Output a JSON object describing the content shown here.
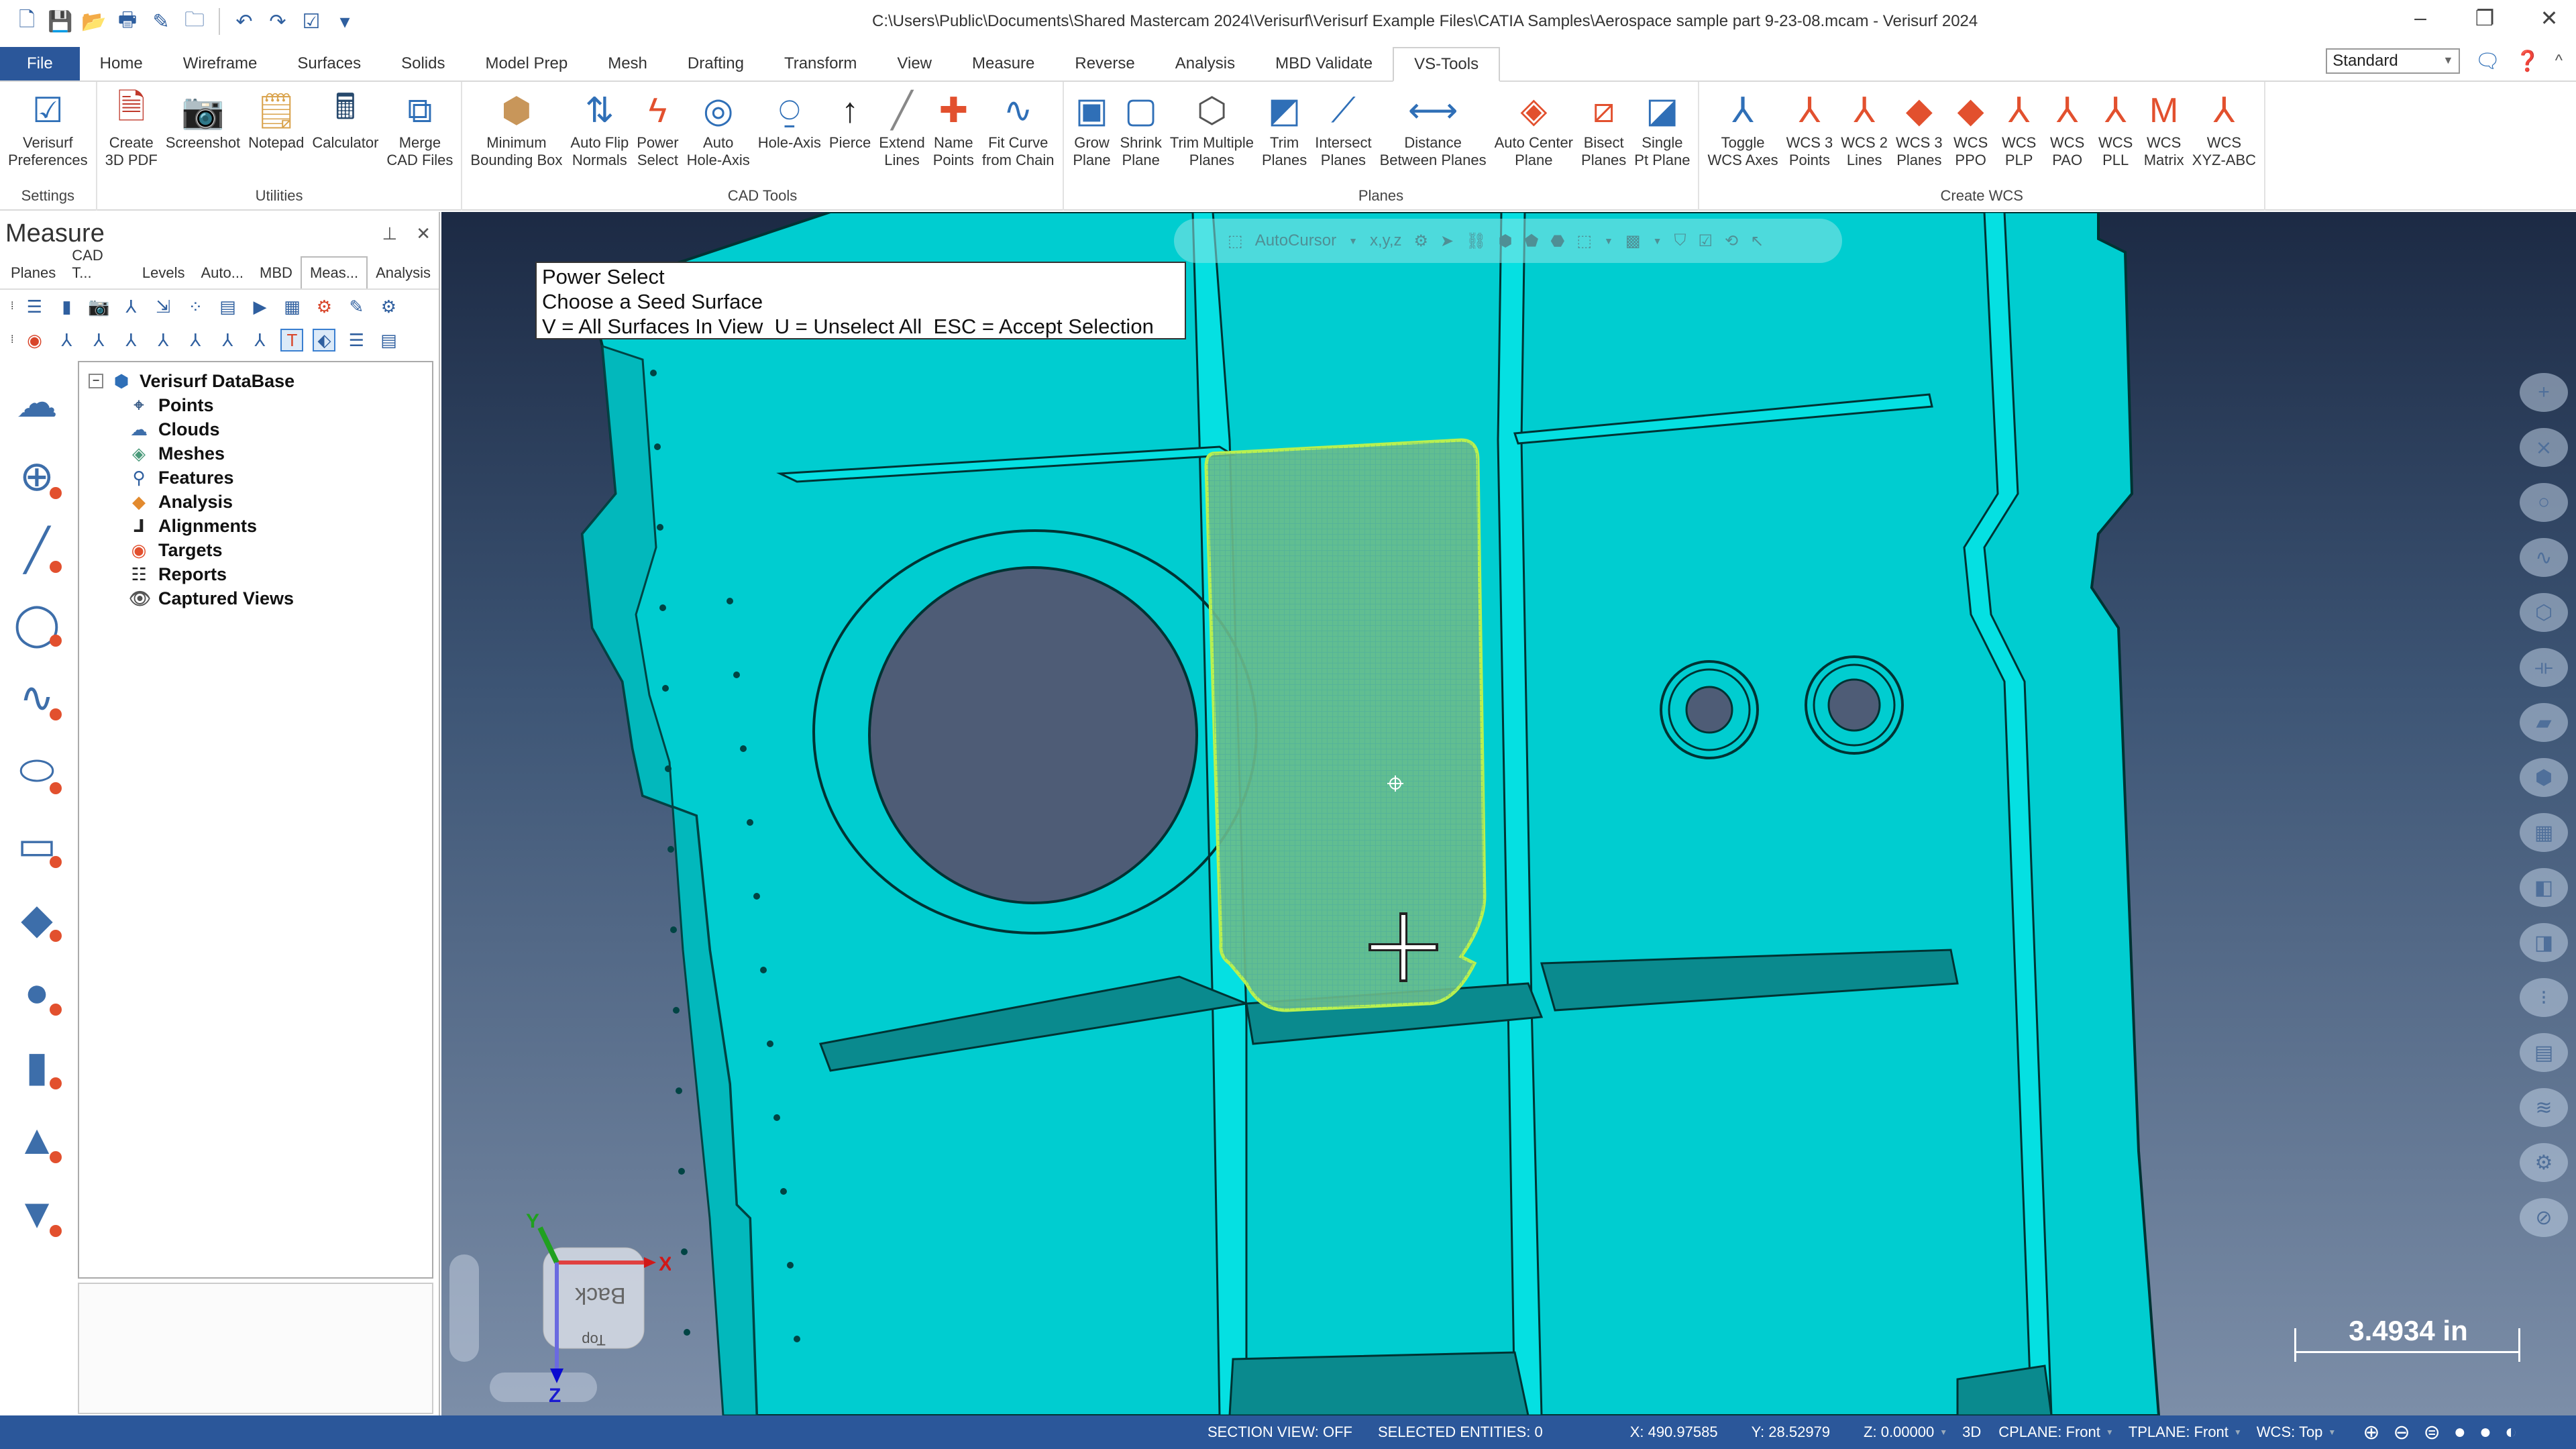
{
  "window": {
    "title": "C:\\Users\\Public\\Documents\\Shared Mastercam 2024\\Verisurf\\Verisurf Example Files\\CATIA Samples\\Aerospace sample part 9-23-08.mcam - Verisurf 2024",
    "minimize": "–",
    "restore": "❐",
    "close": "✕"
  },
  "quick_access": [
    {
      "name": "new-file-icon",
      "glyph": "🗋"
    },
    {
      "name": "save-icon",
      "glyph": "💾"
    },
    {
      "name": "open-folder-icon",
      "glyph": "📂"
    },
    {
      "name": "print-icon",
      "glyph": "🖶"
    },
    {
      "name": "save-as-icon",
      "glyph": "✎"
    },
    {
      "name": "zip-folder-icon",
      "glyph": "🗀"
    },
    {
      "name": "undo-icon",
      "glyph": "↶"
    },
    {
      "name": "redo-icon",
      "glyph": "↷"
    },
    {
      "name": "checklist-icon",
      "glyph": "☑"
    },
    {
      "name": "customize-qat-icon",
      "glyph": "▾"
    }
  ],
  "ribbon": {
    "tabs": [
      "File",
      "Home",
      "Wireframe",
      "Surfaces",
      "Solids",
      "Model Prep",
      "Mesh",
      "Drafting",
      "Transform",
      "View",
      "Measure",
      "Reverse",
      "Analysis",
      "MBD Validate",
      "VS-Tools"
    ],
    "active_tab": "VS-Tools",
    "style_select": "Standard",
    "groups": [
      {
        "label": "Settings",
        "items": [
          {
            "label": "Verisurf\nPreferences",
            "icon": "preferences-icon",
            "glyph": "☑",
            "color": "#2f6fb7"
          }
        ]
      },
      {
        "label": "Utilities",
        "items": [
          {
            "label": "Create\n3D PDF",
            "icon": "pdf-3d-icon",
            "glyph": "🗎",
            "color": "#c0392b"
          },
          {
            "label": "Screenshot",
            "icon": "screenshot-icon",
            "glyph": "📷",
            "color": "#3b6fb0"
          },
          {
            "label": "Notepad",
            "icon": "notepad-icon",
            "glyph": "🗒",
            "color": "#d9a24b"
          },
          {
            "label": "Calculator",
            "icon": "calculator-icon",
            "glyph": "🖩",
            "color": "#27496d"
          },
          {
            "label": "Merge\nCAD Files",
            "icon": "merge-icon",
            "glyph": "⧉",
            "color": "#2f6fb7"
          }
        ]
      },
      {
        "label": "CAD Tools",
        "items": [
          {
            "label": "Minimum\nBounding Box",
            "icon": "bounding-box-icon",
            "glyph": "⬢",
            "color": "#c8965a"
          },
          {
            "label": "Auto Flip\nNormals",
            "icon": "flip-normals-icon",
            "glyph": "⇅",
            "color": "#2f6fb7"
          },
          {
            "label": "Power\nSelect",
            "icon": "lightning-icon",
            "glyph": "ϟ",
            "color": "#e2502e"
          },
          {
            "label": "Auto\nHole-Axis",
            "icon": "auto-hole-axis-icon",
            "glyph": "◎",
            "color": "#2f6fb7"
          },
          {
            "label": "Hole-Axis",
            "icon": "hole-axis-icon",
            "glyph": "⍜",
            "color": "#2f6fb7"
          },
          {
            "label": "Pierce",
            "icon": "pierce-icon",
            "glyph": "↑",
            "color": "#222"
          },
          {
            "label": "Extend\nLines",
            "icon": "extend-lines-icon",
            "glyph": "╱",
            "color": "#888"
          },
          {
            "label": "Name\nPoints",
            "icon": "name-points-icon",
            "glyph": "✚",
            "color": "#e2502e"
          },
          {
            "label": "Fit Curve\nfrom Chain",
            "icon": "fit-curve-icon",
            "glyph": "∿",
            "color": "#2f6fb7"
          }
        ]
      },
      {
        "label": "Planes",
        "items": [
          {
            "label": "Grow\nPlane",
            "icon": "grow-plane-icon",
            "glyph": "▣",
            "color": "#2f6fb7"
          },
          {
            "label": "Shrink\nPlane",
            "icon": "shrink-plane-icon",
            "glyph": "▢",
            "color": "#2f6fb7"
          },
          {
            "label": "Trim Multiple\nPlanes",
            "icon": "trim-multiple-icon",
            "glyph": "⬡",
            "color": "#555"
          },
          {
            "label": "Trim\nPlanes",
            "icon": "trim-planes-icon",
            "glyph": "◩",
            "color": "#2f6fb7"
          },
          {
            "label": "Intersect\nPlanes",
            "icon": "intersect-planes-icon",
            "glyph": "⟋",
            "color": "#2f6fb7"
          },
          {
            "label": "Distance\nBetween Planes",
            "icon": "distance-planes-icon",
            "glyph": "⟷",
            "color": "#2f6fb7"
          },
          {
            "label": "Auto Center\nPlane",
            "icon": "auto-center-plane-icon",
            "glyph": "◈",
            "color": "#e2502e"
          },
          {
            "label": "Bisect\nPlanes",
            "icon": "bisect-planes-icon",
            "glyph": "⧄",
            "color": "#e2502e"
          },
          {
            "label": "Single\nPt Plane",
            "icon": "single-pt-plane-icon",
            "glyph": "◪",
            "color": "#2f6fb7"
          }
        ]
      },
      {
        "label": "Create WCS",
        "items": [
          {
            "label": "Toggle\nWCS Axes",
            "icon": "toggle-wcs-icon",
            "glyph": "⅄",
            "color": "#2f6fb7"
          },
          {
            "label": "WCS 3\nPoints",
            "icon": "wcs-3-points-icon",
            "glyph": "⅄",
            "color": "#e2502e"
          },
          {
            "label": "WCS 2\nLines",
            "icon": "wcs-2-lines-icon",
            "glyph": "⅄",
            "color": "#e2502e"
          },
          {
            "label": "WCS 3\nPlanes",
            "icon": "wcs-3-planes-icon",
            "glyph": "◆",
            "color": "#e2502e"
          },
          {
            "label": "WCS\nPPO",
            "icon": "wcs-ppo-icon",
            "glyph": "◆",
            "color": "#e2502e"
          },
          {
            "label": "WCS\nPLP",
            "icon": "wcs-plp-icon",
            "glyph": "⅄",
            "color": "#e2502e"
          },
          {
            "label": "WCS\nPAO",
            "icon": "wcs-pao-icon",
            "glyph": "⅄",
            "color": "#e2502e"
          },
          {
            "label": "WCS\nPLL",
            "icon": "wcs-pll-icon",
            "glyph": "⅄",
            "color": "#e2502e"
          },
          {
            "label": "WCS\nMatrix",
            "icon": "wcs-matrix-icon",
            "glyph": "M",
            "color": "#e2502e"
          },
          {
            "label": "WCS\nXYZ-ABC",
            "icon": "wcs-xyz-abc-icon",
            "glyph": "⅄",
            "color": "#e2502e"
          }
        ]
      }
    ]
  },
  "left_panel": {
    "title": "Measure",
    "pin": "📌",
    "close": "✕",
    "tabs": [
      "Planes",
      "CAD T...",
      "Levels",
      "Auto...",
      "MBD",
      "Meas...",
      "Analysis"
    ],
    "active_tab": "Meas...",
    "toolbar_row1": [
      {
        "name": "checklist-icon",
        "glyph": "☰"
      },
      {
        "name": "book-icon",
        "glyph": "▮"
      },
      {
        "name": "camera-icon",
        "glyph": "📷"
      },
      {
        "name": "axes-icon",
        "glyph": "⅄"
      },
      {
        "name": "import-icon",
        "glyph": "⇲"
      },
      {
        "name": "point-import-icon",
        "glyph": "⁘"
      },
      {
        "name": "list-icon",
        "glyph": "▤"
      },
      {
        "name": "play-icon",
        "glyph": "▶"
      },
      {
        "name": "report-icon",
        "glyph": "▦"
      },
      {
        "name": "probe-settings-icon",
        "glyph": "⚙"
      },
      {
        "name": "edit-file-icon",
        "glyph": "✎"
      },
      {
        "name": "device-settings-icon",
        "glyph": "⚙"
      }
    ],
    "toolbar_row2": [
      {
        "name": "target-icon",
        "glyph": "◉",
        "selected": false
      },
      {
        "name": "align-best-fit-icon",
        "glyph": "⅄",
        "selected": false
      },
      {
        "name": "align-points-icon",
        "glyph": "⅄",
        "selected": false
      },
      {
        "name": "align-3-2-1-icon",
        "glyph": "⅄",
        "selected": false
      },
      {
        "name": "align-feature-icon",
        "glyph": "⅄",
        "selected": false
      },
      {
        "name": "align-analysis-icon",
        "glyph": "⅄",
        "selected": false
      },
      {
        "name": "align-box-icon",
        "glyph": "⅄",
        "selected": false
      },
      {
        "name": "align-wcs-icon",
        "glyph": "⅄",
        "selected": false
      },
      {
        "name": "robot-arm-icon",
        "glyph": "T",
        "selected": true
      },
      {
        "name": "tag-icon",
        "glyph": "⬖",
        "selected": true
      },
      {
        "name": "layer-list-icon",
        "glyph": "☰",
        "selected": false
      },
      {
        "name": "device-icon",
        "glyph": "▤",
        "selected": false
      }
    ],
    "side_tools": [
      {
        "name": "cloud-measure-icon",
        "glyph": "☁"
      },
      {
        "name": "point-measure-icon",
        "glyph": "⊕"
      },
      {
        "name": "line-measure-icon",
        "glyph": "╱"
      },
      {
        "name": "circle-measure-icon",
        "glyph": "◯"
      },
      {
        "name": "curve-measure-icon",
        "glyph": "∿"
      },
      {
        "name": "ellipse-measure-icon",
        "glyph": "⬭"
      },
      {
        "name": "slot-measure-icon",
        "glyph": "▭"
      },
      {
        "name": "plane-measure-icon",
        "glyph": "◆"
      },
      {
        "name": "sphere-measure-icon",
        "glyph": "●"
      },
      {
        "name": "cylinder-measure-icon",
        "glyph": "▮"
      },
      {
        "name": "cone-measure-icon",
        "glyph": "▲"
      },
      {
        "name": "countersink-measure-icon",
        "glyph": "▼"
      }
    ],
    "tree": {
      "root": "Verisurf DataBase",
      "items": [
        {
          "label": "Points",
          "icon": "points-icon",
          "glyph": "⌖",
          "color": "#3d5f8a"
        },
        {
          "label": "Clouds",
          "icon": "clouds-icon",
          "glyph": "☁",
          "color": "#3d6eaa"
        },
        {
          "label": "Meshes",
          "icon": "meshes-icon",
          "glyph": "◈",
          "color": "#4a9a7a"
        },
        {
          "label": "Features",
          "icon": "features-icon",
          "glyph": "⚲",
          "color": "#2f5f9f"
        },
        {
          "label": "Analysis",
          "icon": "analysis-icon",
          "glyph": "◆",
          "color": "#e28a2e"
        },
        {
          "label": "Alignments",
          "icon": "alignments-icon",
          "glyph": "⅃",
          "color": "#222"
        },
        {
          "label": "Targets",
          "icon": "targets-icon",
          "glyph": "◉",
          "color": "#e2502e"
        },
        {
          "label": "Reports",
          "icon": "reports-icon",
          "glyph": "☷",
          "color": "#222"
        },
        {
          "label": "Captured Views",
          "icon": "captured-views-icon",
          "glyph": "👁",
          "color": "#555"
        }
      ]
    }
  },
  "viewport": {
    "prompt": {
      "line1": "Power Select",
      "line2": "Choose a Seed Surface",
      "line3": "V = All Surfaces In View  U = Unselect All  ESC = Accept Selection"
    },
    "autocursor": {
      "label": "AutoCursor",
      "xyz_label": "x,y,z"
    },
    "nav_buttons": [
      {
        "name": "point-nav-icon",
        "glyph": "+"
      },
      {
        "name": "line-nav-icon",
        "glyph": "⨯"
      },
      {
        "name": "circle-nav-icon",
        "glyph": "○"
      },
      {
        "name": "spline-nav-icon",
        "glyph": "∿"
      },
      {
        "name": "wireframe-box-icon",
        "glyph": "⬡"
      },
      {
        "name": "dimension-nav-icon",
        "glyph": "⟛"
      },
      {
        "name": "surface-nav-icon",
        "glyph": "▰"
      },
      {
        "name": "solid-box-icon",
        "glyph": "⬢"
      },
      {
        "name": "shaded-box-icon",
        "glyph": "▦"
      },
      {
        "name": "levels-blue-icon",
        "glyph": "◧"
      },
      {
        "name": "levels-red-icon",
        "glyph": "◨"
      },
      {
        "name": "tree-nav-icon",
        "glyph": "⁝"
      },
      {
        "name": "grid-nav-icon",
        "glyph": "▤"
      },
      {
        "name": "layers-nav-icon",
        "glyph": "≋"
      },
      {
        "name": "settings-nav-icon",
        "glyph": "⚙"
      },
      {
        "name": "cancel-nav-icon",
        "glyph": "⊘"
      }
    ],
    "view_cube": {
      "front_label": "Back",
      "bottom_label": "Top",
      "x_label": "X",
      "y_label": "Y",
      "z_label": "Z"
    },
    "scale": "3.4934 in",
    "colors": {
      "model": "#00cdd0",
      "model_shadow": "#0a8a8e",
      "selected_surface": "#6bbd8a",
      "selected_edge": "#b8f050",
      "hole": "#4e5c76"
    }
  },
  "statusbar": {
    "section_view": "SECTION VIEW: OFF",
    "selected_entities": "SELECTED ENTITIES: 0",
    "x": "X:   490.97585",
    "y": "Y:   28.52979",
    "z": "Z:   0.00000",
    "mode": "3D",
    "cplane": "CPLANE: Front",
    "tplane": "TPLANE: Front",
    "wcs": "WCS: Top",
    "icons": [
      {
        "name": "wireframe-globe-icon",
        "glyph": "⊕"
      },
      {
        "name": "hidden-globe-icon",
        "glyph": "⊖"
      },
      {
        "name": "hidden-line-globe-icon",
        "glyph": "⊜"
      },
      {
        "name": "shaded-sphere-icon",
        "glyph": "●"
      },
      {
        "name": "shaded-edges-sphere-icon",
        "glyph": "●"
      },
      {
        "name": "section-sphere-icon",
        "glyph": "◐"
      }
    ]
  }
}
